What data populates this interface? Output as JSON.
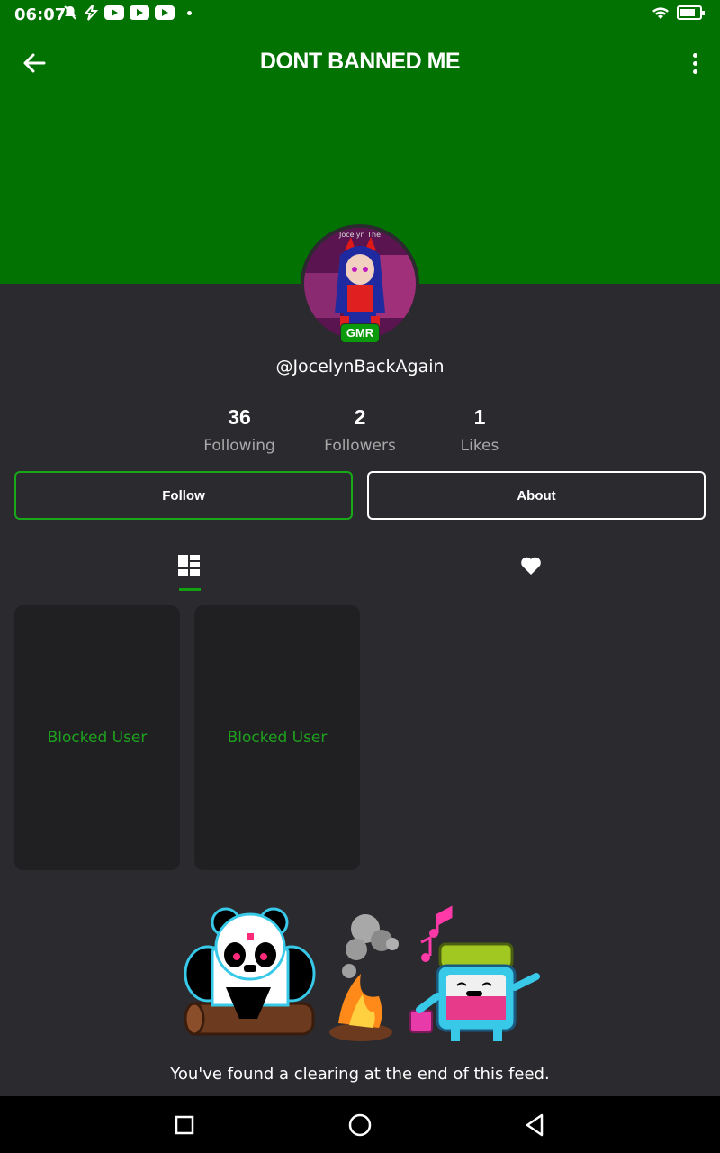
{
  "status_bar": {
    "time": "06:07"
  },
  "header": {
    "title": "DONT BANNED ME",
    "background_color": "#027302"
  },
  "profile": {
    "avatar_badge": "GMR",
    "avatar_caption": "Jocelyn The",
    "username": "@JocelynBackAgain",
    "stats": [
      {
        "value": "36",
        "label": "Following"
      },
      {
        "value": "2",
        "label": "Followers"
      },
      {
        "value": "1",
        "label": "Likes"
      }
    ]
  },
  "actions": {
    "follow_label": "Follow",
    "about_label": "About"
  },
  "tabs": [
    {
      "icon": "grid-icon",
      "active": true
    },
    {
      "icon": "heart-icon",
      "active": false
    }
  ],
  "posts": [
    {
      "label": "Blocked User"
    },
    {
      "label": "Blocked User"
    }
  ],
  "feed_end": {
    "message": "You've found a clearing at the end of this feed."
  },
  "colors": {
    "accent": "#10a010",
    "background": "#2b2a2f",
    "card": "#202022",
    "blocked_text": "#1ea11e"
  }
}
